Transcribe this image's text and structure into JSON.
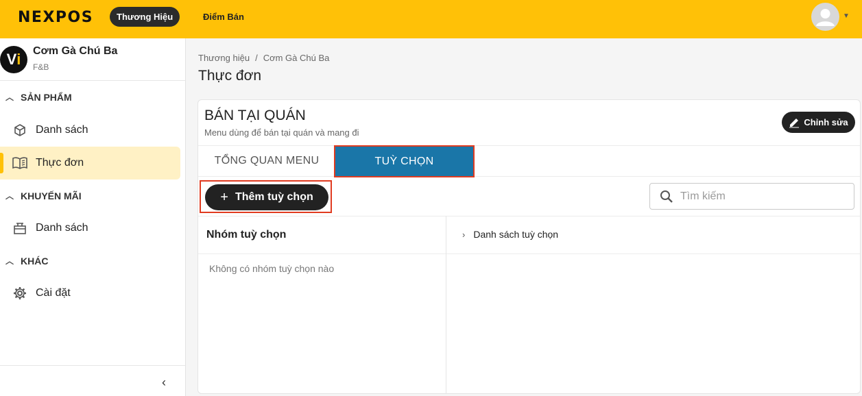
{
  "header": {
    "logo": "NEXPOS",
    "nav_active": "Thương Hiệu",
    "nav_other": "Điểm Bán"
  },
  "sidebar": {
    "store_name": "Cơm Gà Chú Ba",
    "store_type": "F&B",
    "sections": [
      {
        "title": "SẢN PHẨM",
        "items": [
          {
            "label": "Danh sách",
            "icon": "box-icon"
          },
          {
            "label": "Thực đơn",
            "icon": "menu-book-icon",
            "active": true
          }
        ]
      },
      {
        "title": "KHUYẾN MÃI",
        "items": [
          {
            "label": "Danh sách",
            "icon": "gift-icon"
          }
        ]
      },
      {
        "title": "KHÁC",
        "items": [
          {
            "label": "Cài đặt",
            "icon": "gear-icon"
          }
        ]
      }
    ]
  },
  "breadcrumb": [
    "Thương hiệu",
    "/",
    "Cơm Gà Chú Ba"
  ],
  "page_title": "Thực đơn",
  "card": {
    "title": "BÁN TẠI QUÁN",
    "subtitle": "Menu dùng để bán tại quán và mang đi",
    "edit_label": "Chỉnh sửa",
    "tabs": [
      "TỔNG QUAN MENU",
      "TUỲ CHỌN"
    ],
    "active_tab": 1,
    "add_label": "Thêm tuỳ chọn",
    "search_placeholder": "Tìm kiếm",
    "left_col_title": "Nhóm tuỳ chọn",
    "right_col_title": "Danh sách tuỳ chọn",
    "empty_text": "Không có nhóm tuỳ chọn nào"
  },
  "colors": {
    "brand": "#ffc107",
    "active_tab": "#1a76a8",
    "highlight_border": "#e03b20",
    "dark": "#222222"
  }
}
